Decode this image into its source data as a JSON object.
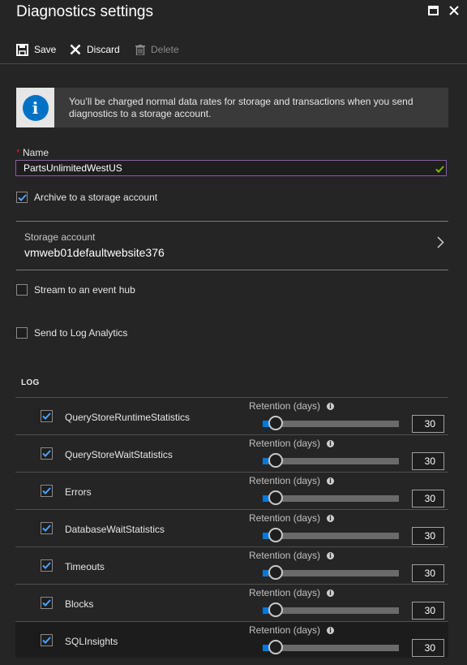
{
  "window": {
    "title": "Diagnostics settings"
  },
  "toolbar": {
    "save_label": "Save",
    "discard_label": "Discard",
    "delete_label": "Delete"
  },
  "info": {
    "text": "You’ll be charged normal data rates for storage and transactions when you send diagnostics to a storage account."
  },
  "name_field": {
    "label": "Name",
    "value": "PartsUnlimitedWestUS"
  },
  "archive": {
    "label": "Archive to a storage account",
    "checked": true
  },
  "storage_account": {
    "label": "Storage account",
    "value": "vmweb01defaultwebsite376"
  },
  "event_hub": {
    "label": "Stream to an event hub",
    "checked": false
  },
  "log_analytics": {
    "label": "Send to Log Analytics",
    "checked": false
  },
  "log_section": {
    "header": "LOG",
    "retention_label": "Retention (days)",
    "rows": [
      {
        "name": "QueryStoreRuntimeStatistics",
        "checked": true,
        "retention": "30",
        "slider_level": 0.05
      },
      {
        "name": "QueryStoreWaitStatistics",
        "checked": true,
        "retention": "30",
        "slider_level": 0.05
      },
      {
        "name": "Errors",
        "checked": true,
        "retention": "30",
        "slider_level": 0.05
      },
      {
        "name": "DatabaseWaitStatistics",
        "checked": true,
        "retention": "30",
        "slider_level": 0.05
      },
      {
        "name": "Timeouts",
        "checked": true,
        "retention": "30",
        "slider_level": 0.05
      },
      {
        "name": "Blocks",
        "checked": true,
        "retention": "30",
        "slider_level": 0.05
      },
      {
        "name": "SQLInsights",
        "checked": true,
        "retention": "30",
        "slider_level": 0.05
      }
    ]
  },
  "colors": {
    "accent": "#0078d7",
    "background": "#252526",
    "valid": "#7fba00",
    "required": "#e81123"
  },
  "icons": {
    "save": "save-icon",
    "discard": "close-icon",
    "delete": "trash-icon",
    "info": "info-icon",
    "maximize": "maximize-icon",
    "close": "close-icon"
  }
}
